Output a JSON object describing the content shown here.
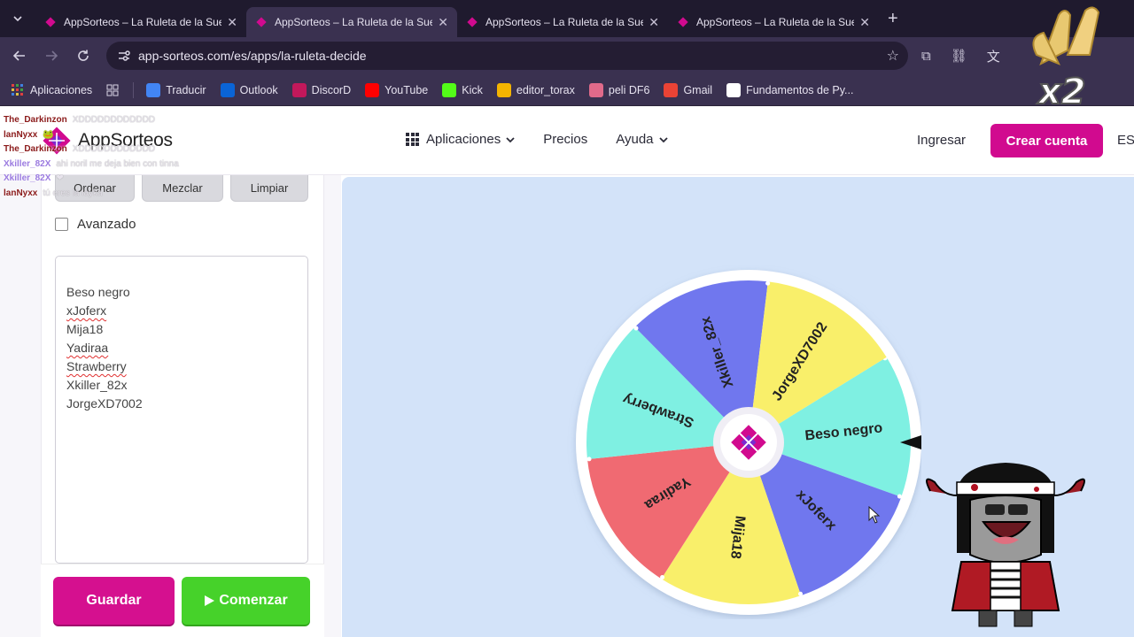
{
  "browser": {
    "tabs": [
      {
        "title": "AppSorteos – La Ruleta de la Suerte",
        "active": false
      },
      {
        "title": "AppSorteos – La Ruleta de la Suerte",
        "active": true
      },
      {
        "title": "AppSorteos – La Ruleta de la Suerte",
        "active": false
      },
      {
        "title": "AppSorteos – La Ruleta de la Suerte",
        "active": false
      }
    ],
    "url": "app-sorteos.com/es/apps/la-ruleta-decide",
    "bookmarks": [
      {
        "label": "Aplicaciones",
        "icon": "apps-grid-icon"
      },
      {
        "label": "Traducir",
        "icon": "translate-icon",
        "color": "#4285f4"
      },
      {
        "label": "Outlook",
        "icon": "outlook-icon",
        "color": "#0a64d6"
      },
      {
        "label": "DiscorD",
        "icon": "discord-icon",
        "color": "#c2185b"
      },
      {
        "label": "YouTube",
        "icon": "youtube-icon",
        "color": "#ff0000"
      },
      {
        "label": "Kick",
        "icon": "kick-icon",
        "color": "#53fc18"
      },
      {
        "label": "editor_torax",
        "icon": "editor-icon",
        "color": "#f4b400"
      },
      {
        "label": "peli DF6",
        "icon": "peli-icon",
        "color": "#e06a8a"
      },
      {
        "label": "Gmail",
        "icon": "gmail-icon",
        "color": "#ea4335"
      },
      {
        "label": "Fundamentos de Py...",
        "icon": "doc-icon",
        "color": "#ffffff"
      }
    ]
  },
  "header": {
    "logo": "AppSorteos",
    "nav": [
      {
        "label": "Aplicaciones",
        "has_dropdown": true
      },
      {
        "label": "Precios",
        "has_dropdown": false
      },
      {
        "label": "Ayuda",
        "has_dropdown": true
      }
    ],
    "login": "Ingresar",
    "signup": "Crear cuenta",
    "language": "ES"
  },
  "chat": [
    {
      "user": "The_Darkinzon",
      "msg": "XDDDDDDDDDDDD",
      "color": "#8b1a1a"
    },
    {
      "user": "lanNyxx",
      "msg": "🐸",
      "color": "#8b1a1a"
    },
    {
      "user": "The_Darkinzon",
      "msg": "XDDDDDDDDDDDD",
      "color": "#8b1a1a"
    },
    {
      "user": "Xkiller_82X",
      "msg": "ahi noril me deja bien con tinna",
      "color": "#9b7be0"
    },
    {
      "user": "Xkiller_82X",
      "msg": "❤",
      "color": "#9b7be0"
    },
    {
      "user": "lanNyxx",
      "msg": "tú eres la layka",
      "color": "#8b1a1a"
    }
  ],
  "panel": {
    "buttons": {
      "ordenar": "Ordenar",
      "mezclar": "Mezclar",
      "limpiar": "Limpiar"
    },
    "advanced_label": "Avanzado",
    "advanced_checked": false,
    "entries": [
      "Beso negro",
      "xJoferx",
      "Mija18",
      "Yadiraa",
      "Strawberry",
      "Xkiller_82x",
      "JorgeXD7002"
    ],
    "entries_spellcheck_flagged": [
      false,
      true,
      false,
      true,
      true,
      false,
      false
    ],
    "save": "Guardar",
    "start": "Comenzar"
  },
  "wheel": {
    "segments": [
      {
        "label": "Beso negro",
        "color": "#7ff0e2"
      },
      {
        "label": "xJoferx",
        "color": "#7077ee"
      },
      {
        "label": "Mija18",
        "color": "#f9ef6a"
      },
      {
        "label": "Yadiraa",
        "color": "#f06a72"
      },
      {
        "label": "Strawberry",
        "color": "#7ff0e2"
      },
      {
        "label": "Xkiller_82x",
        "color": "#7077ee"
      },
      {
        "label": "JorgeXD7002",
        "color": "#f9ef6a"
      }
    ]
  },
  "overlay": {
    "multiplier": "x2"
  },
  "colors": {
    "brand": "#d10a8f",
    "start": "#46d22a",
    "wheel_bg": "#d3e3f9"
  }
}
